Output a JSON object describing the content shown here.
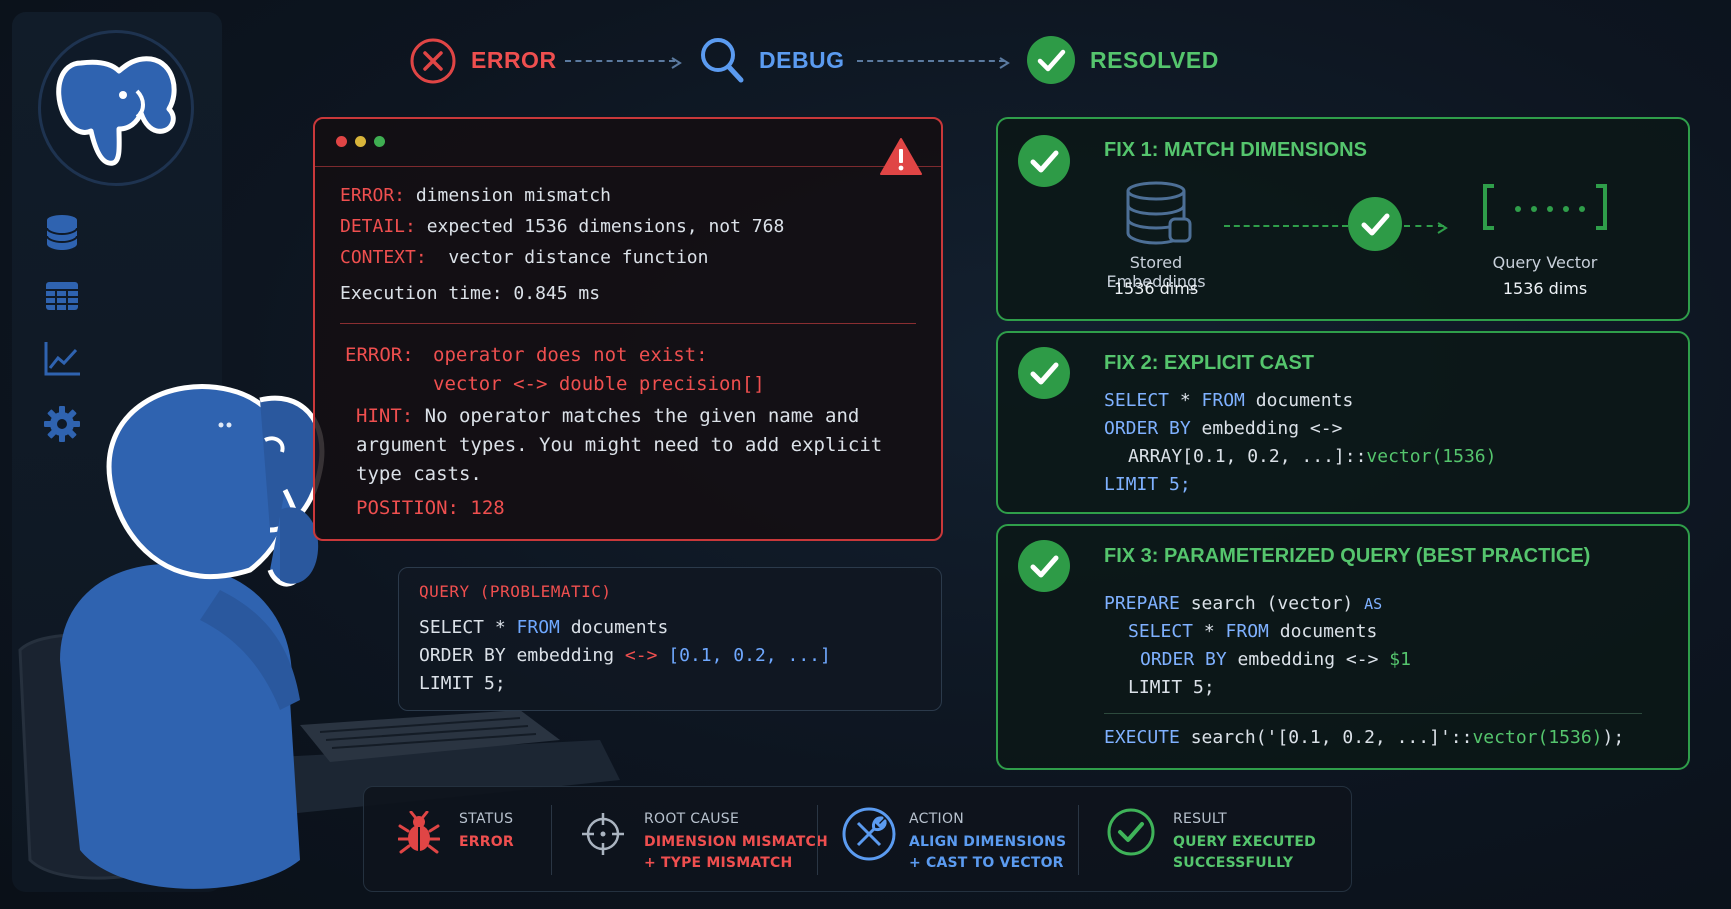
{
  "flow": {
    "error": "ERROR",
    "debug": "DEBUG",
    "resolved": "RESOLVED"
  },
  "error_panel": {
    "line1_key": "ERROR:",
    "line1_val": "dimension mismatch",
    "line2_key": "DETAIL:",
    "line2_val": "expected 1536 dimensions, not 768",
    "line3_key": "CONTEXT:",
    "line3_val": "vector distance function",
    "exec_time": "Execution time: 0.845 ms",
    "error2_key": "ERROR:",
    "error2_line1": "operator does not exist:",
    "error2_line2": "vector <-> double precision[]",
    "hint_key": "HINT:",
    "hint_line1": "No operator matches the given name and",
    "hint_line2": "argument types. You might need to add explicit",
    "hint_line3": "type casts.",
    "position": "POSITION: 128"
  },
  "query_panel": {
    "title": "QUERY (PROBLEMATIC)",
    "l1_kw1": "SELECT",
    "l1_mid": " * ",
    "l1_kw2": "FROM",
    "l1_rest": " documents",
    "l2_kw": "ORDER BY",
    "l2_mid": " embedding ",
    "l2_op": "<->",
    "l2_arr": " [0.1, 0.2, ...]",
    "l3": "LIMIT 5;"
  },
  "fix1": {
    "title": "FIX 1: MATCH DIMENSIONS",
    "left_label": "Stored Embeddings",
    "left_val": "1536 dims",
    "right_label": "Query Vector",
    "right_val": "1536 dims"
  },
  "fix2": {
    "title": "FIX 2: EXPLICIT CAST",
    "l1_kw1": "SELECT",
    "l1_mid": " * ",
    "l1_kw2": "FROM",
    "l1_rest": " documents",
    "l2_kw": "ORDER BY",
    "l2_rest": " embedding <->",
    "l3_a": "ARRAY[0.1, 0.2, ...]::",
    "l3_b": "vector(1536)",
    "l4": "LIMIT 5;"
  },
  "fix3": {
    "title": "FIX 3: PARAMETERIZED QUERY (BEST PRACTICE)",
    "l1_kw": "PREPARE",
    "l1_rest": " search (vector) ",
    "l1_as": "AS",
    "l2_kw1": "SELECT",
    "l2_mid": " * ",
    "l2_kw2": "FROM",
    "l2_rest": " documents",
    "l3_kw": "ORDER BY",
    "l3_rest": " embedding <-> ",
    "l3_param": "$1",
    "l4": "LIMIT 5;",
    "l5_kw": "EXECUTE",
    "l5_mid": " search('[0.1, 0.2, ...]'::",
    "l5_cast": "vector(1536)",
    "l5_end": ");"
  },
  "status": {
    "s1_label": "STATUS",
    "s1_val": "ERROR",
    "s2_label": "ROOT CAUSE",
    "s2_val1": "DIMENSION MISMATCH",
    "s2_val2": "+ TYPE MISMATCH",
    "s3_label": "ACTION",
    "s3_val1": "ALIGN DIMENSIONS",
    "s3_val2": "+ CAST TO VECTOR",
    "s4_label": "RESULT",
    "s4_val1": "QUERY EXECUTED",
    "s4_val2": "SUCCESSFULLY"
  },
  "colors": {
    "error": "#ef4f4f",
    "debug": "#5b9bf0",
    "resolved": "#55c56d",
    "elephant": "#2f63b0"
  },
  "icons": [
    "postgres-elephant-logo",
    "database-icon",
    "table-icon",
    "chart-icon",
    "gear-icon",
    "error-x-icon",
    "magnifier-icon",
    "check-icon",
    "warning-icon",
    "bug-icon",
    "target-icon",
    "wrench-icon"
  ]
}
